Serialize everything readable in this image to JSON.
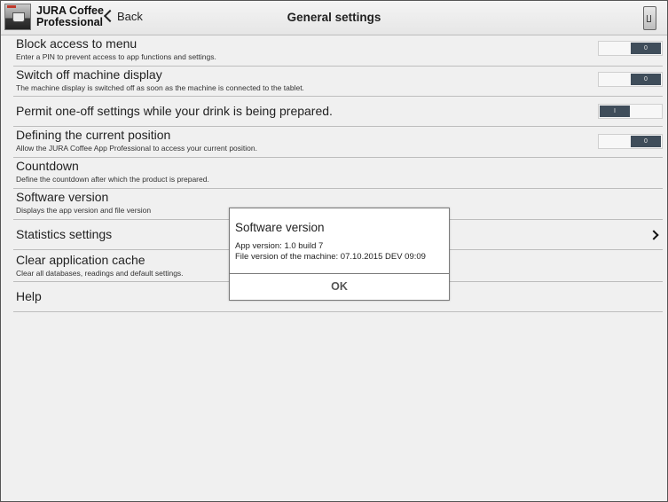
{
  "header": {
    "app_name_line1": "JURA Coffee",
    "app_name_line2": "Professional",
    "back_label": "Back",
    "title": "General settings",
    "icons": {
      "app": "jura-app-icon",
      "back": "chevron-left-icon",
      "machine": "coffee-machine-icon"
    }
  },
  "settings": [
    {
      "title": "Block access to menu",
      "description": "Enter a PIN to prevent access to app functions and settings.",
      "control": "toggle",
      "state": "off",
      "toggle_label": "0"
    },
    {
      "title": "Switch off machine display",
      "description": "The machine display is switched off as soon as the machine is connected to the tablet.",
      "control": "toggle",
      "state": "off",
      "toggle_label": "0"
    },
    {
      "title": "Permit one-off settings while your drink is being prepared.",
      "control": "toggle",
      "state": "on",
      "toggle_label": "I"
    },
    {
      "title": "Defining the current position",
      "description": "Allow the JURA Coffee App Professional to access your current position.",
      "control": "toggle",
      "state": "off",
      "toggle_label": "0"
    },
    {
      "title": "Countdown",
      "description": "Define the countdown after which the product is prepared."
    },
    {
      "title": "Software version",
      "description": "Displays the app version and file version"
    },
    {
      "title": "Statistics settings",
      "control": "chevron"
    },
    {
      "title": "Clear application cache",
      "description": "Clear all databases, readings and default settings."
    },
    {
      "title": "Help"
    }
  ],
  "dialog": {
    "title": "Software version",
    "line1": "App version: 1.0 build 7",
    "line2": "File version of the machine: 07.10.2015 DEV 09:09",
    "ok_label": "OK"
  },
  "colors": {
    "toggle_knob": "#3f4d5a",
    "background": "#f0f0f0",
    "divider": "#bdbdbd"
  }
}
